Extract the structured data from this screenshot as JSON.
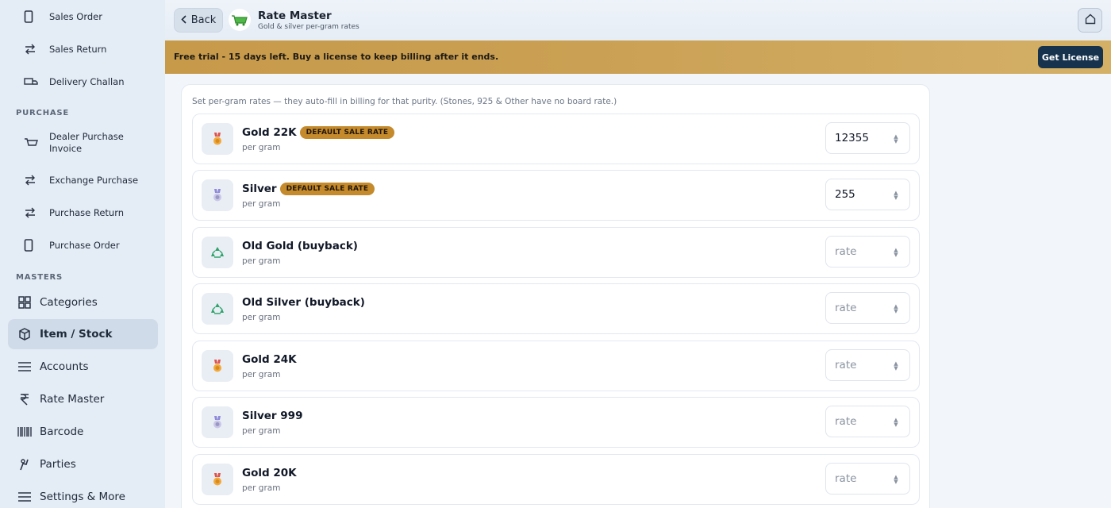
{
  "sidebar": {
    "sales_items": [
      {
        "label": "Sales Order",
        "icon": "mobile-doc-icon"
      },
      {
        "label": "Sales Return",
        "icon": "swap-arrows-icon"
      },
      {
        "label": "Delivery Challan",
        "icon": "truck-icon"
      }
    ],
    "purchase_section": "PURCHASE",
    "purchase_items": [
      {
        "label": "Dealer Purchase Invoice",
        "icon": "cart-icon"
      },
      {
        "label": "Exchange Purchase",
        "icon": "swap-arrows-icon"
      },
      {
        "label": "Purchase Return",
        "icon": "swap-arrows-icon"
      },
      {
        "label": "Purchase Order",
        "icon": "mobile-doc-icon"
      }
    ],
    "masters_section": "MASTERS",
    "masters_items": [
      {
        "label": "Categories",
        "icon": "grid-icon"
      },
      {
        "label": "Item / Stock",
        "icon": "box-icon",
        "active": true
      },
      {
        "label": "Accounts",
        "icon": "menu-lines-icon"
      },
      {
        "label": "Rate Master",
        "icon": "rupee-icon"
      },
      {
        "label": "Barcode",
        "icon": "barcode-icon"
      },
      {
        "label": "Parties",
        "icon": "person-icon"
      },
      {
        "label": "Settings & More",
        "icon": "menu-lines-icon"
      }
    ]
  },
  "header": {
    "back_label": "Back",
    "title": "Rate Master",
    "subtitle": "Gold & silver per-gram rates"
  },
  "banner": {
    "text": "Free trial - 15 days left. Buy a license to keep billing after it ends.",
    "button_label": "Get License"
  },
  "main": {
    "hint": "Set per-gram rates — they auto-fill in billing for that purity. (Stones, 925 & Other have no board rate.)",
    "default_tag": "DEFAULT SALE RATE",
    "unit_label": "per gram",
    "placeholder": "rate",
    "rates": [
      {
        "name": "Gold 22K",
        "value": "12355",
        "default": true,
        "icon": "gold-medal-icon"
      },
      {
        "name": "Silver",
        "value": "255",
        "default": true,
        "icon": "silver-medal-icon"
      },
      {
        "name": "Old Gold (buyback)",
        "value": "",
        "default": false,
        "icon": "recycle-icon"
      },
      {
        "name": "Old Silver (buyback)",
        "value": "",
        "default": false,
        "icon": "recycle-icon"
      },
      {
        "name": "Gold 24K",
        "value": "",
        "default": false,
        "icon": "gold-medal-icon"
      },
      {
        "name": "Silver 999",
        "value": "",
        "default": false,
        "icon": "silver-medal-icon"
      },
      {
        "name": "Gold 20K",
        "value": "",
        "default": false,
        "icon": "gold-medal-icon"
      }
    ]
  },
  "colors": {
    "banner": "#c79a4a",
    "license_button": "#16324d",
    "default_tag": "#c48a2c",
    "active_nav": "#cfdbe8"
  }
}
